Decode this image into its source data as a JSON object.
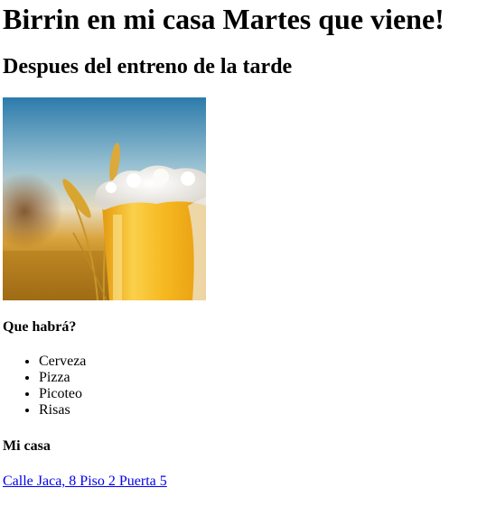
{
  "page": {
    "title": "Birrin en mi casa Martes que viene!",
    "subtitle": "Despues del entreno de la tarde"
  },
  "image": {
    "subject": "beer glass with wheat",
    "colors": {
      "sky_top": "#2f7fb0",
      "sky_mid": "#cfe0e6",
      "field": "#c98a14",
      "beer": "#f4b81e",
      "foam": "#f6f4ee",
      "wheat": "#d9a531"
    }
  },
  "section_what": {
    "heading": "Que habrá?",
    "items": [
      "Cerveza",
      "Pizza",
      "Picoteo",
      "Risas"
    ]
  },
  "section_where": {
    "heading": "Mi casa",
    "address_link": "Calle Jaca, 8 Piso 2 Puerta 5",
    "link_color": "#0000ee"
  }
}
